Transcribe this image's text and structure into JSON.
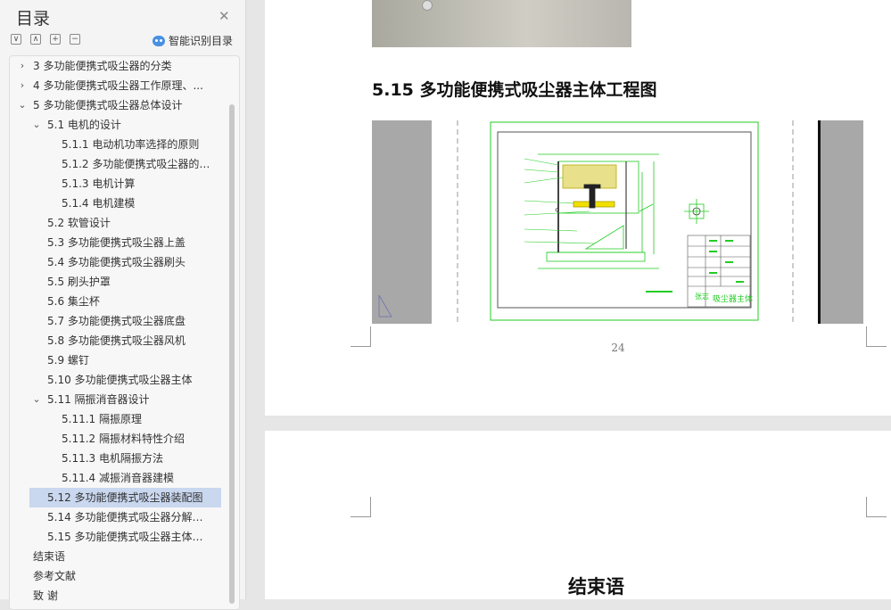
{
  "sidebar": {
    "title": "目录",
    "smart_toc_label": "智能识别目录",
    "toolbar": {
      "collapse_all": "∨",
      "expand_up": "∧",
      "add": "+",
      "remove": "−"
    },
    "items": [
      {
        "label": "3  多功能便携式吸尘器的分类",
        "level": 0,
        "chevron": "›"
      },
      {
        "label": "4  多功能便携式吸尘器工作原理、...",
        "level": 0,
        "chevron": "›"
      },
      {
        "label": "5  多功能便携式吸尘器总体设计",
        "level": 0,
        "chevron": "⌄"
      },
      {
        "label": "5.1 电机的设计",
        "level": 1,
        "chevron": "⌄"
      },
      {
        "label": "5.1.1 电动机功率选择的原则",
        "level": 2
      },
      {
        "label": "5.1.2 多功能便携式吸尘器的 ...",
        "level": 2
      },
      {
        "label": "5.1.3 电机计算",
        "level": 2
      },
      {
        "label": "5.1.4 电机建模",
        "level": 2
      },
      {
        "label": "5.2 软管设计",
        "level": 1
      },
      {
        "label": "5.3 多功能便携式吸尘器上盖",
        "level": 1
      },
      {
        "label": "5.4 多功能便携式吸尘器刷头",
        "level": 1
      },
      {
        "label": "5.5 刷头护罩",
        "level": 1
      },
      {
        "label": "5.6 集尘杯",
        "level": 1
      },
      {
        "label": "5.7 多功能便携式吸尘器底盘",
        "level": 1
      },
      {
        "label": "5.8 多功能便携式吸尘器风机",
        "level": 1
      },
      {
        "label": "5.9 螺钉",
        "level": 1
      },
      {
        "label": "5.10 多功能便携式吸尘器主体",
        "level": 1
      },
      {
        "label": "5.11 隔振消音器设计",
        "level": 1,
        "chevron": "⌄"
      },
      {
        "label": "5.11.1 隔振原理",
        "level": 2
      },
      {
        "label": "5.11.2 隔振材料特性介绍",
        "level": 2
      },
      {
        "label": "5.11.3 电机隔振方法",
        "level": 2
      },
      {
        "label": "5.11.4 减振消音器建模",
        "level": 2
      },
      {
        "label": "5.12 多功能便携式吸尘器装配图",
        "level": 1,
        "active": true
      },
      {
        "label": "5.14 多功能便携式吸尘器分解视 ...",
        "level": 1
      },
      {
        "label": "5.15 多功能便携式吸尘器主体工 ...",
        "level": 1
      },
      {
        "label": "结束语",
        "level": 0
      },
      {
        "label": "参考文献",
        "level": 0
      },
      {
        "label": "致   谢",
        "level": 0
      }
    ]
  },
  "document": {
    "section_heading": "5.15 多功能便携式吸尘器主体工程图",
    "page_number": "24",
    "next_page_heading": "结束语",
    "drawing_title_block": "吸尘器主体",
    "drawing_material_note": "张志"
  },
  "colors": {
    "cad_line": "#22cc22",
    "cad_part_fill": "#e8e08a",
    "cad_fill_yellow": "#f0e000",
    "active_row": "#c9d7ef"
  }
}
